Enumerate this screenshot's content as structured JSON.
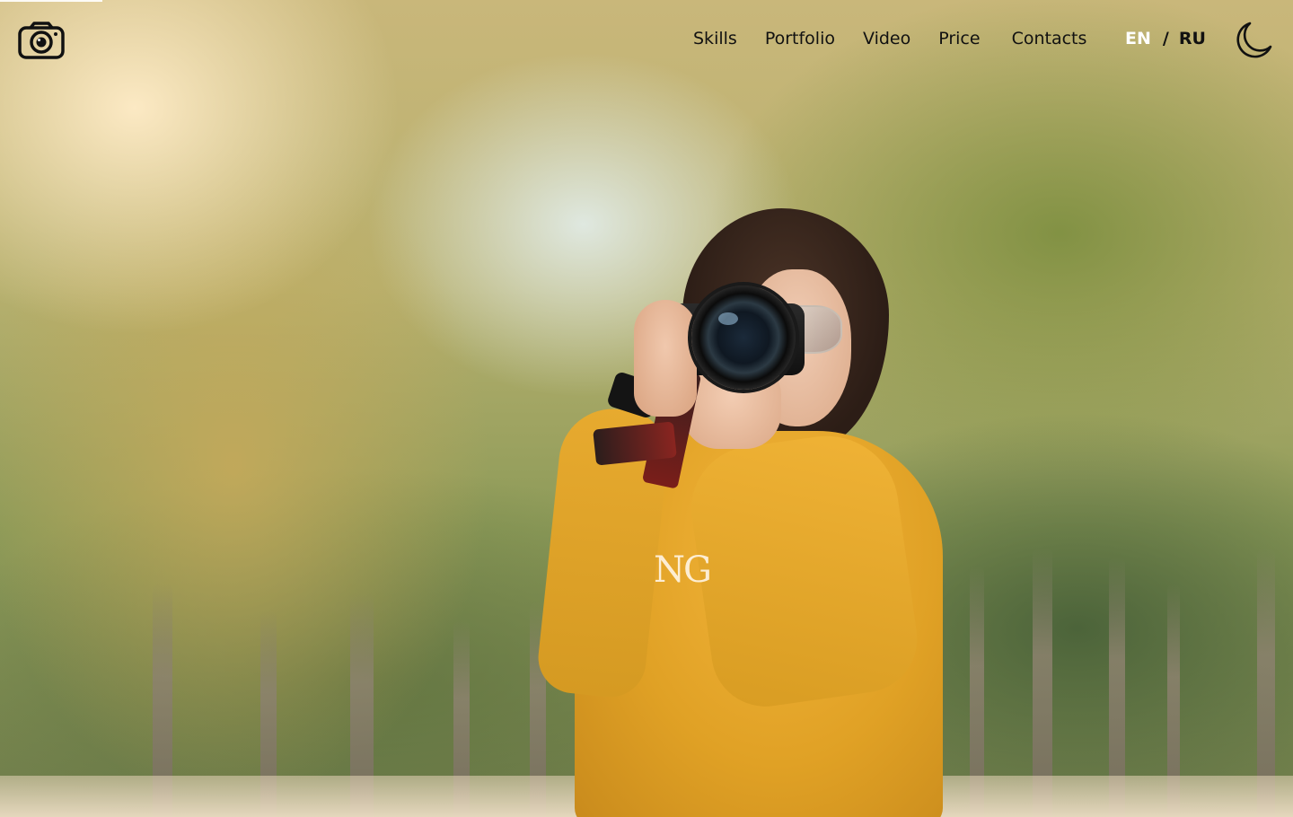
{
  "header": {
    "logo_icon": "camera-icon",
    "nav": [
      {
        "label": "Skills"
      },
      {
        "label": "Portfolio"
      },
      {
        "label": "Video"
      },
      {
        "label": "Price"
      },
      {
        "label": "Contacts"
      }
    ],
    "language": {
      "en": "EN",
      "separator": "/",
      "ru": "RU",
      "active": "EN"
    },
    "theme_toggle_icon": "moon-icon"
  },
  "hero": {
    "background_image": "photographer-with-camera",
    "sweater_print": "NG"
  },
  "colors": {
    "nav_text": "#111111",
    "active_lang": "#ffffff",
    "sweater": "#e0a125"
  }
}
